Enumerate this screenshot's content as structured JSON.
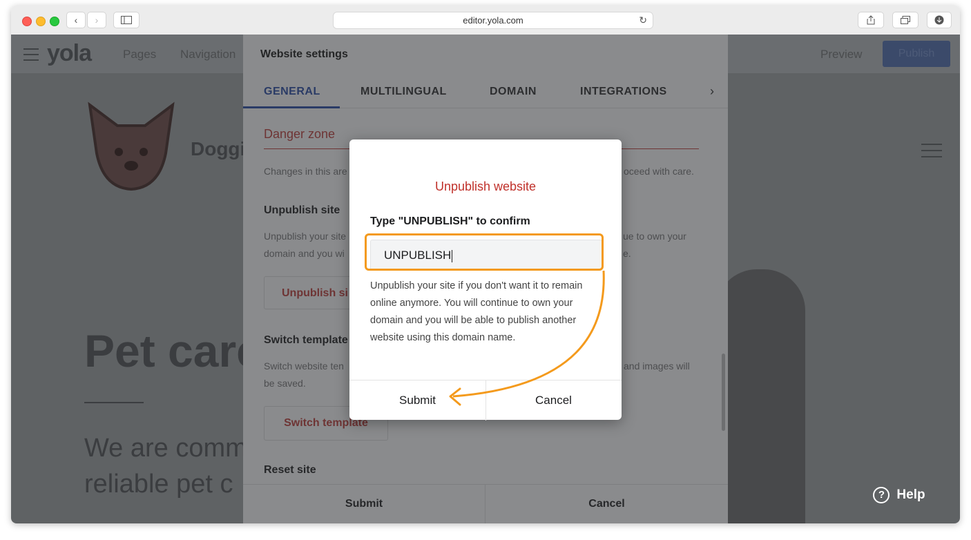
{
  "browser": {
    "url": "editor.yola.com",
    "reload_icon": "reload-icon",
    "share_icon": "share-icon",
    "tabs_icon": "tabs-icon",
    "download_icon": "download-icon"
  },
  "editor": {
    "logo": "yola",
    "nav": [
      "Pages",
      "Navigation"
    ],
    "preview_label": "Preview",
    "publish_label": "Publish"
  },
  "site_bg": {
    "brand": "Doggi",
    "hero_title": "Pet care",
    "hero_sub_1": "We are comm",
    "hero_sub_2": "reliable pet c"
  },
  "settings": {
    "title": "Website settings",
    "tabs": [
      "GENERAL",
      "MULTILINGUAL",
      "DOMAIN",
      "INTEGRATIONS"
    ],
    "active_tab": "GENERAL",
    "danger_zone": "Danger zone",
    "danger_desc_left": "Changes in this are",
    "danger_desc_right": "oceed with care.",
    "unpublish_title": "Unpublish site",
    "unpublish_desc_1_left": "Unpublish your site",
    "unpublish_desc_1_right": "ue to own your",
    "unpublish_desc_2_left": "domain and you wi",
    "unpublish_desc_2_right": "e.",
    "unpublish_btn": "Unpublish si",
    "switch_title": "Switch template",
    "switch_desc_1_left": "Switch website ten",
    "switch_desc_1_right": "and images will",
    "switch_desc_2": "be saved.",
    "switch_btn": "Switch template",
    "reset_title": "Reset site",
    "footer_submit": "Submit",
    "footer_cancel": "Cancel"
  },
  "modal": {
    "title": "Unpublish website",
    "label": "Type \"UNPUBLISH\" to confirm",
    "input_value": "UNPUBLISH",
    "description": "Unpublish your site if you don't want it to remain online anymore. You will continue to own your domain and you will be able to publish another website using this domain name.",
    "submit_label": "Submit",
    "cancel_label": "Cancel"
  },
  "help": {
    "label": "Help"
  },
  "colors": {
    "highlight": "#f49a1c",
    "danger": "#c0312b",
    "publish": "#3b4a6a"
  }
}
